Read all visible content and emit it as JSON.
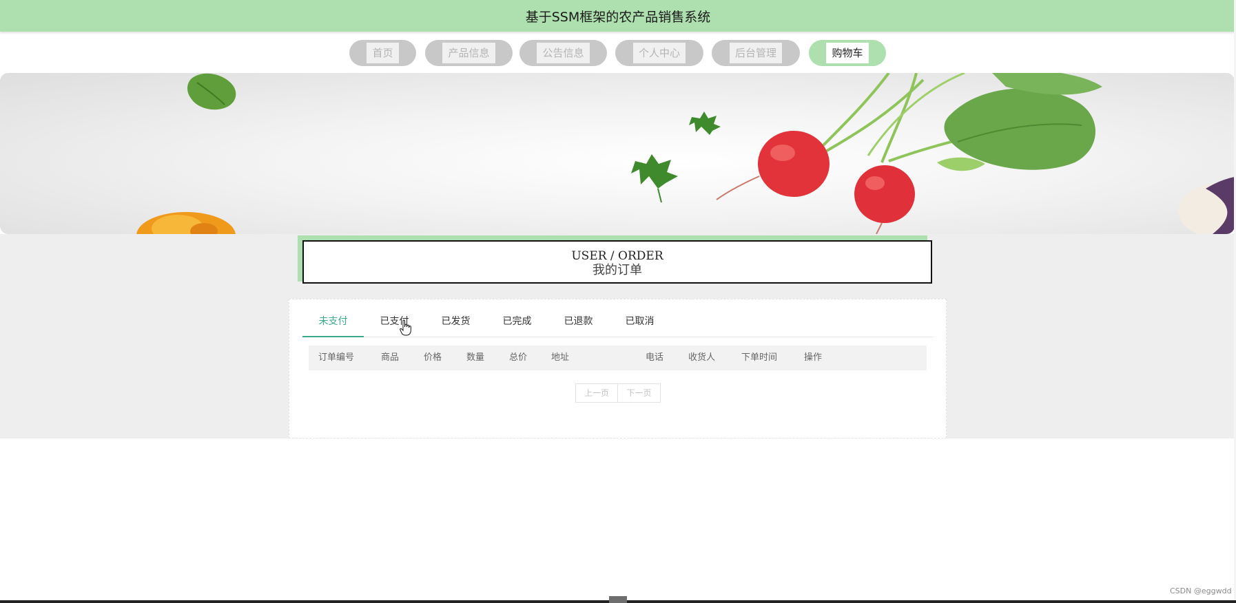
{
  "app": {
    "title": "基于SSM框架的农产品销售系统"
  },
  "nav": {
    "items": [
      {
        "label": "首页",
        "active": false
      },
      {
        "label": "产品信息",
        "active": false
      },
      {
        "label": "公告信息",
        "active": false
      },
      {
        "label": "个人中心",
        "active": false
      },
      {
        "label": "后台管理",
        "active": false
      },
      {
        "label": "购物车",
        "active": true
      }
    ]
  },
  "page": {
    "title_en": "USER / ORDER",
    "title_cn": "我的订单"
  },
  "tabs": [
    {
      "label": "未支付",
      "active": true
    },
    {
      "label": "已支付",
      "active": false
    },
    {
      "label": "已发货",
      "active": false
    },
    {
      "label": "已完成",
      "active": false
    },
    {
      "label": "已退款",
      "active": false
    },
    {
      "label": "已取消",
      "active": false
    }
  ],
  "table": {
    "columns": [
      "订单编号",
      "商品",
      "价格",
      "数量",
      "总价",
      "地址",
      "电话",
      "收货人",
      "下单时间",
      "操作"
    ],
    "rows": []
  },
  "pager": {
    "prev": "上一页",
    "next": "下一页"
  },
  "watermark": "CSDN @eggwdd",
  "colors": {
    "header": "#aedfae",
    "accent": "#3aaa8a"
  }
}
